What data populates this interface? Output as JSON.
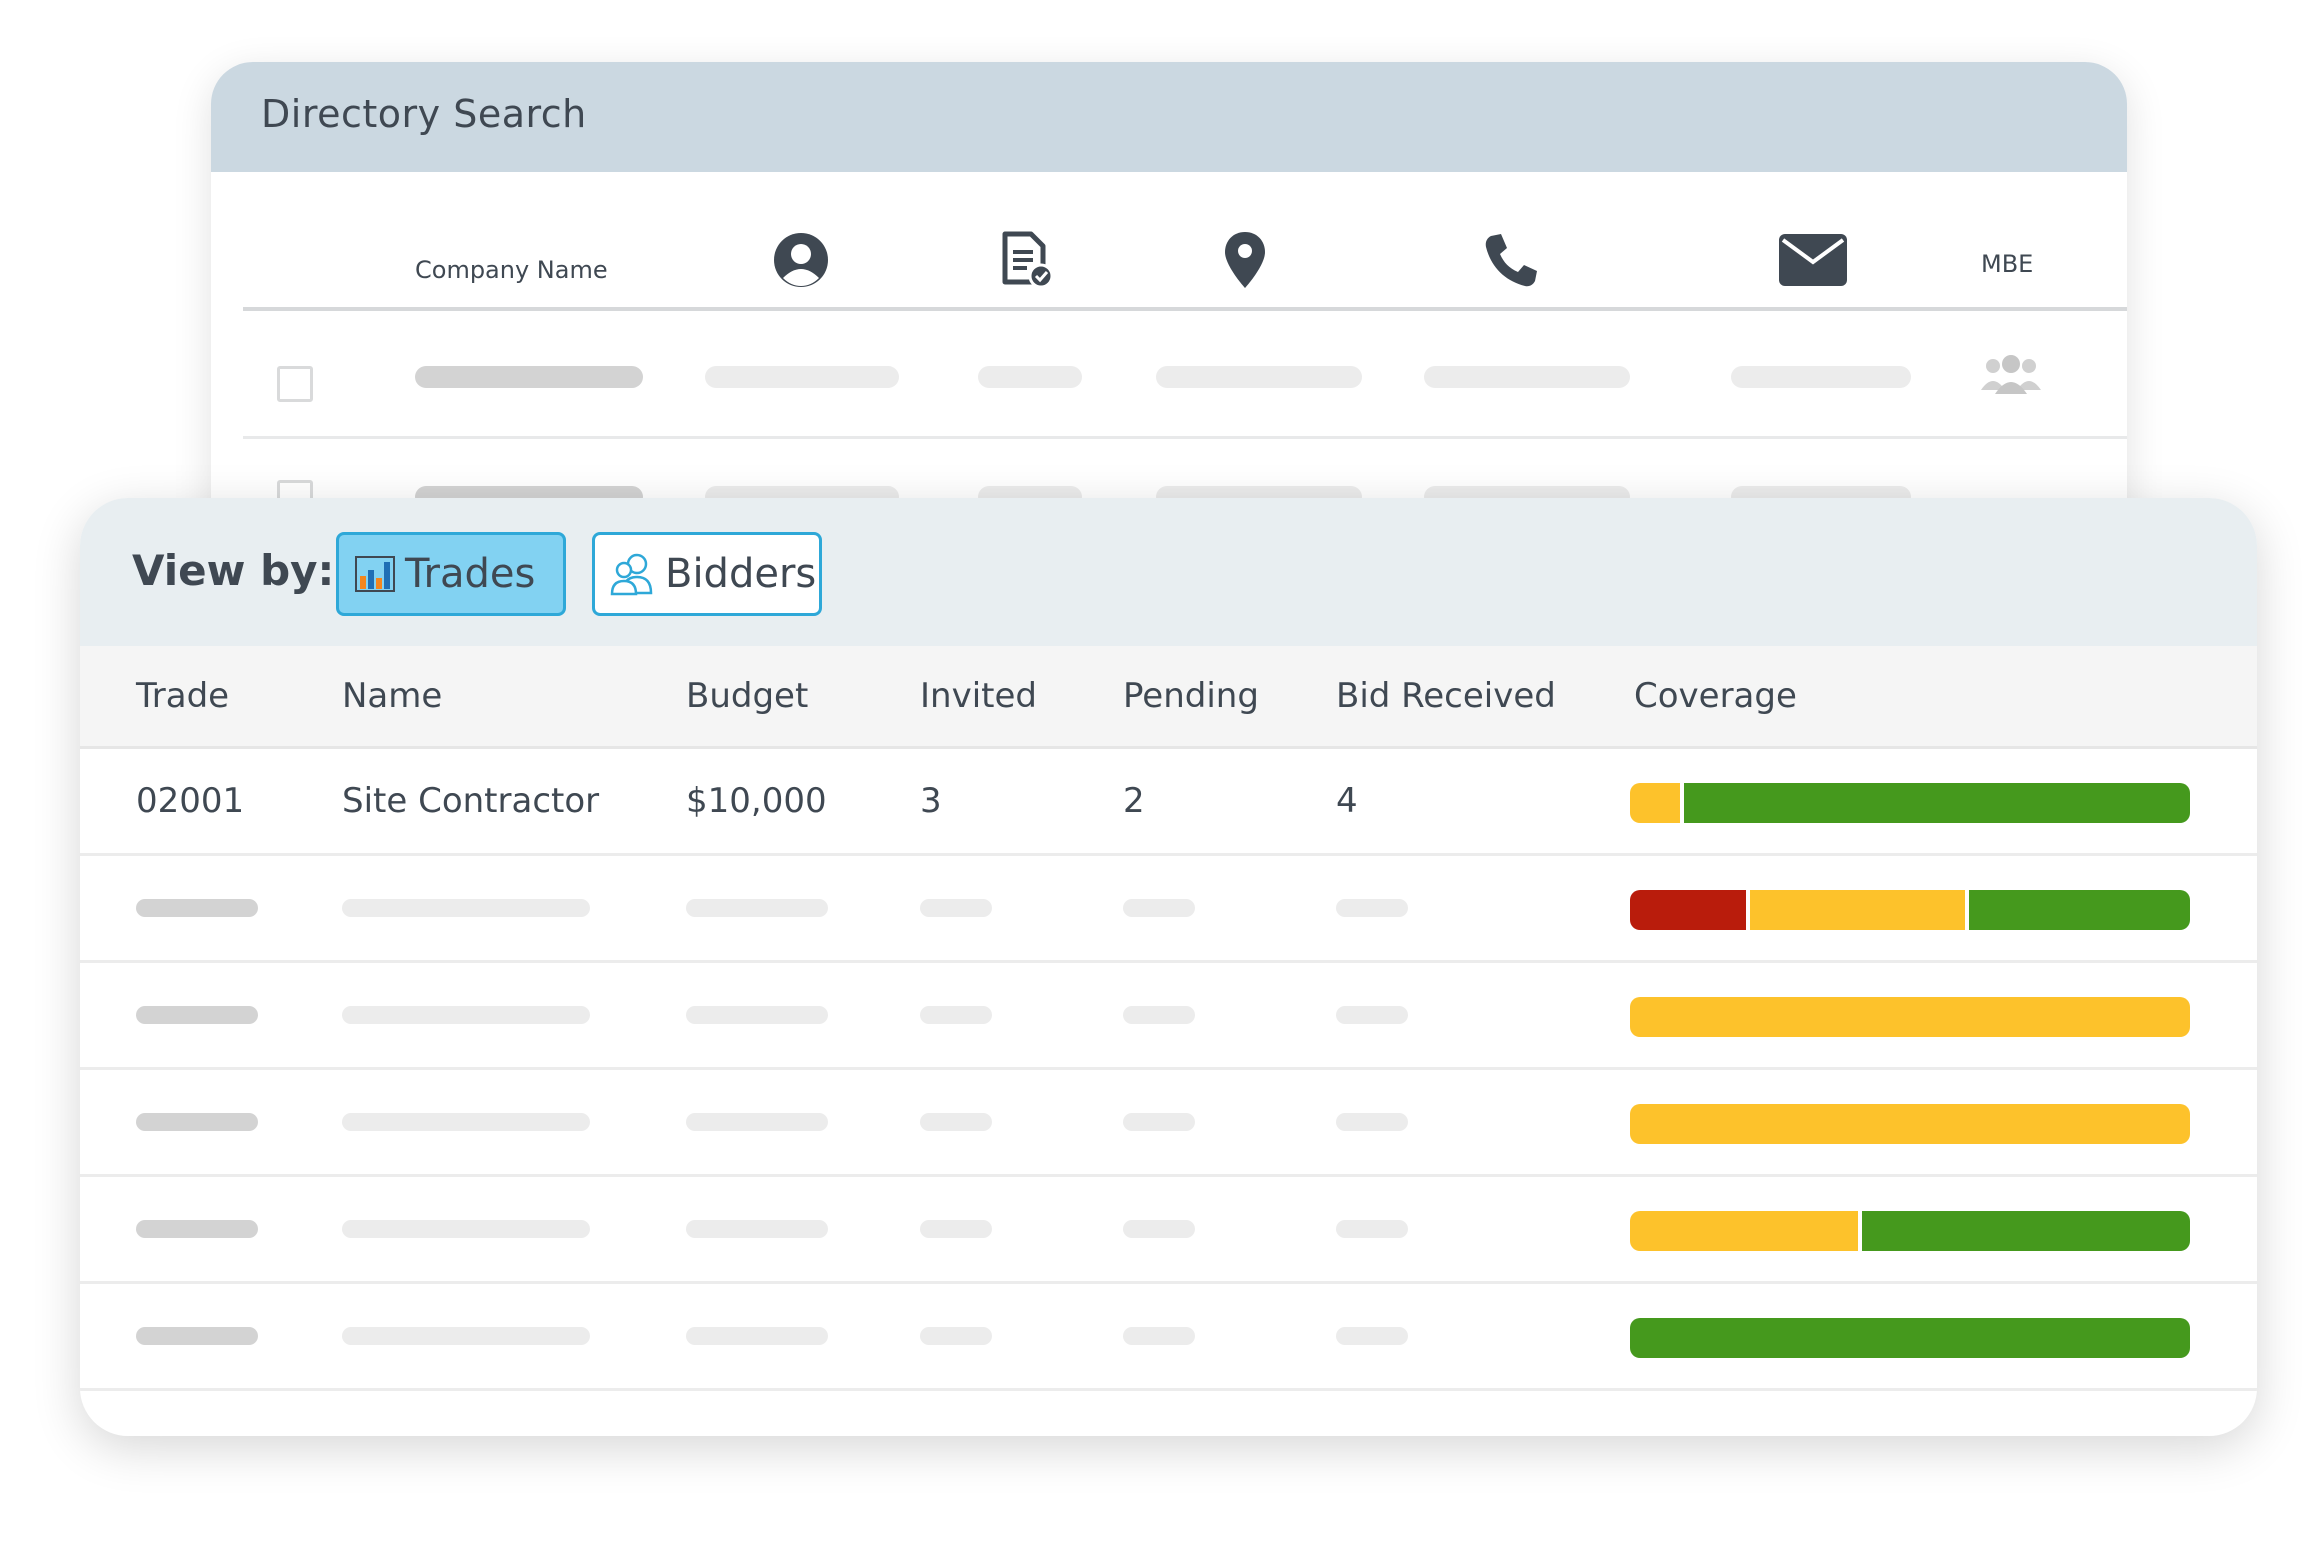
{
  "directory": {
    "title": "Directory Search",
    "columns": {
      "company_name": "Company Name",
      "contact_icon": "person-icon",
      "document_icon": "document-check-icon",
      "location_icon": "location-pin-icon",
      "phone_icon": "phone-icon",
      "email_icon": "envelope-icon",
      "mbe": "MBE"
    },
    "row_icon": "group-icon"
  },
  "view_by": {
    "label": "View by:",
    "options": [
      {
        "label": "Trades",
        "icon": "bar-chart-icon",
        "selected": true
      },
      {
        "label": "Bidders",
        "icon": "users-icon",
        "selected": false
      }
    ]
  },
  "table": {
    "headers": [
      "Trade",
      "Name",
      "Budget",
      "Invited",
      "Pending",
      "Bid Received",
      "Coverage"
    ],
    "first_row": {
      "trade": "02001",
      "name": "Site Contractor",
      "budget": "$10,000",
      "invited": "3",
      "pending": "2",
      "bid_received": "4"
    },
    "coverage": [
      [
        {
          "color": "#fdc22b",
          "fraction": 0.09
        },
        {
          "color": "#45991d",
          "fraction": 0.91
        }
      ],
      [
        {
          "color": "#b91c0c",
          "fraction": 0.21
        },
        {
          "color": "#fdc22b",
          "fraction": 0.39
        },
        {
          "color": "#45991d",
          "fraction": 0.4
        }
      ],
      [
        {
          "color": "#fdc22b",
          "fraction": 1.0
        }
      ],
      [
        {
          "color": "#fdc22b",
          "fraction": 1.0
        }
      ],
      [
        {
          "color": "#fdc22b",
          "fraction": 0.41
        },
        {
          "color": "#45991d",
          "fraction": 0.59
        }
      ],
      [
        {
          "color": "#45991d",
          "fraction": 1.0
        }
      ]
    ]
  },
  "colors": {
    "header_bg": "#cbd8e1",
    "accent": "#2ea8d8",
    "selected_bg": "#82d2f2",
    "red": "#b91c0c",
    "yellow": "#fdc22b",
    "green": "#45991d"
  }
}
